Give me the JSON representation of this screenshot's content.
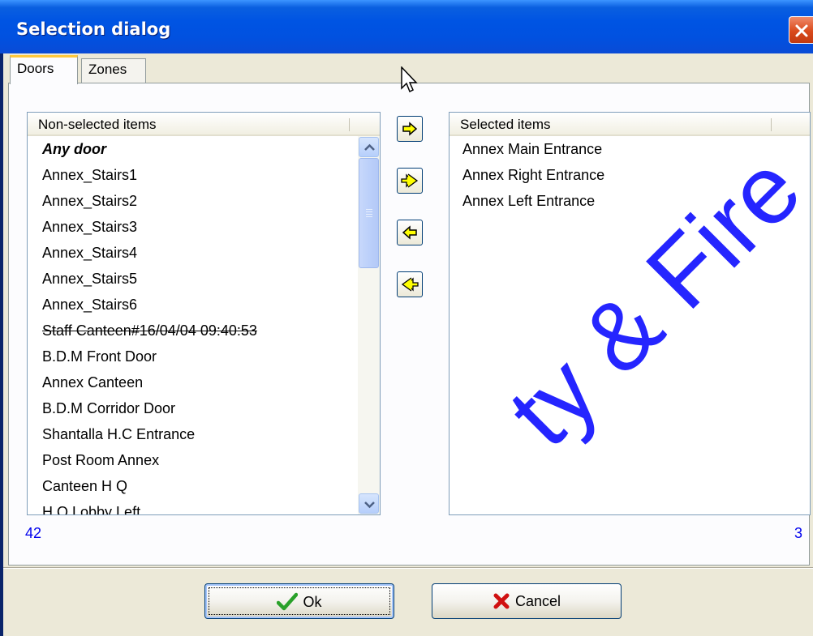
{
  "window": {
    "title": "Selection dialog",
    "close_icon": "close-icon"
  },
  "tabs": [
    {
      "label": "Doors",
      "active": true
    },
    {
      "label": "Zones",
      "active": false
    }
  ],
  "left_list": {
    "header": "Non-selected items",
    "count": "42",
    "items": [
      {
        "label": "Any door",
        "style": "bold-italic"
      },
      {
        "label": "Annex_Stairs1"
      },
      {
        "label": "Annex_Stairs2"
      },
      {
        "label": "Annex_Stairs3"
      },
      {
        "label": "Annex_Stairs4"
      },
      {
        "label": "Annex_Stairs5"
      },
      {
        "label": "Annex_Stairs6"
      },
      {
        "label": "Staff Canteen#16/04/04 09:40:53",
        "style": "strike"
      },
      {
        "label": "B.D.M Front Door"
      },
      {
        "label": "Annex Canteen"
      },
      {
        "label": "B.D.M Corridor Door"
      },
      {
        "label": "Shantalla H.C Entrance"
      },
      {
        "label": "Post Room Annex"
      },
      {
        "label": "Canteen H Q"
      },
      {
        "label": "H Q Lobby Left"
      }
    ]
  },
  "right_list": {
    "header": "Selected items",
    "count": "3",
    "items": [
      {
        "label": "Annex Main Entrance"
      },
      {
        "label": "Annex Right Entrance"
      },
      {
        "label": "Annex Left Entrance"
      }
    ]
  },
  "move_buttons": [
    {
      "icon": "arrow-right-icon"
    },
    {
      "icon": "double-arrow-right-icon"
    },
    {
      "icon": "arrow-left-icon"
    },
    {
      "icon": "double-arrow-left-icon"
    }
  ],
  "footer": {
    "ok_label": "Ok",
    "cancel_label": "Cancel",
    "ok_icon": "checkmark-icon",
    "cancel_icon": "x-icon"
  },
  "watermark": "ty & Fire",
  "colors": {
    "titlebar": "#0054e3",
    "count_text": "#0000ee",
    "arrow_fill": "#ffff00",
    "check_green": "#2aa12a",
    "cancel_red": "#d01010"
  }
}
